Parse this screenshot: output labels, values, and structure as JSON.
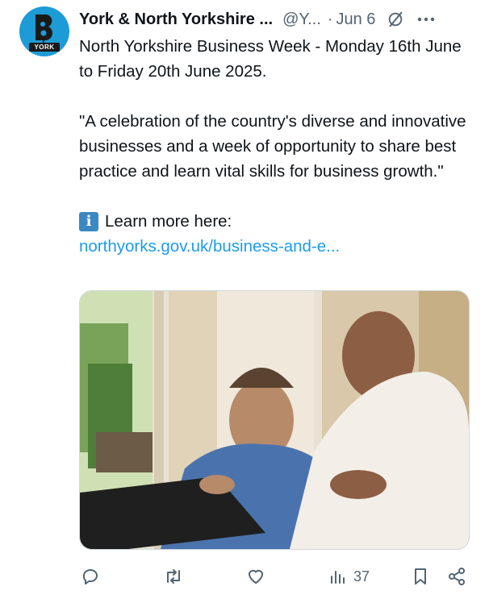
{
  "avatar": {
    "label": "YORK"
  },
  "tweet": {
    "author_name": "York & North Yorkshire ...",
    "handle": "@Y...",
    "separator": "·",
    "date": "Jun 6",
    "paragraphs": [
      "North Yorkshire Business Week - Monday 16th June to Friday 20th June 2025.",
      "\"A celebration of the country's diverse and innovative businesses and a week of opportunity to share best practice and learn vital skills for business growth.\""
    ],
    "info_glyph": "i",
    "learn_more": "Learn more here:",
    "link_text": "northyorks.gov.uk/business-and-e..."
  },
  "actions": {
    "reply_icon": "reply-icon",
    "retweet_icon": "retweet-icon",
    "like_icon": "like-icon",
    "views_icon": "views-icon",
    "views_count": "37",
    "bookmark_icon": "bookmark-icon",
    "share_icon": "share-icon"
  },
  "colors": {
    "link": "#1d9bf0",
    "muted": "#536471",
    "text": "#0f1419",
    "avatar_bg": "#1d9bd6"
  }
}
